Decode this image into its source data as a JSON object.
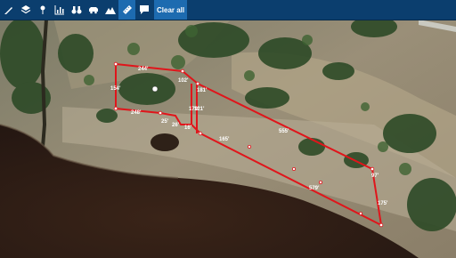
{
  "toolbar": {
    "tools": [
      {
        "name": "draw-line-icon",
        "active": false
      },
      {
        "name": "layers-icon",
        "active": false
      },
      {
        "name": "place-pin-icon",
        "active": false
      },
      {
        "name": "chart-icon",
        "active": false
      },
      {
        "name": "binoculars-icon",
        "active": false
      },
      {
        "name": "car-icon",
        "active": false
      },
      {
        "name": "terrain-icon",
        "active": false
      },
      {
        "name": "ruler-icon",
        "active": true
      },
      {
        "name": "comment-icon",
        "active": false
      }
    ],
    "clear_label": "Clear all"
  },
  "map": {
    "measurements": [
      {
        "id": "seg-1",
        "text": "244'"
      },
      {
        "id": "seg-2",
        "text": "154'"
      },
      {
        "id": "seg-3",
        "text": "248'"
      },
      {
        "id": "seg-4",
        "text": "25'"
      },
      {
        "id": "seg-5",
        "text": "102'"
      },
      {
        "id": "seg-6",
        "text": "181'"
      },
      {
        "id": "seg-7",
        "text": "179'"
      },
      {
        "id": "seg-8",
        "text": "121'"
      },
      {
        "id": "seg-9",
        "text": "26'"
      },
      {
        "id": "seg-10",
        "text": "16'"
      },
      {
        "id": "seg-11",
        "text": "165'"
      },
      {
        "id": "seg-12",
        "text": "555'"
      },
      {
        "id": "seg-13",
        "text": "579'"
      },
      {
        "id": "seg-14",
        "text": "97'"
      },
      {
        "id": "seg-15",
        "text": "175'"
      }
    ],
    "colors": {
      "boundary": "#e0151b",
      "vertex": "#ffffff",
      "water": "#2f1d14"
    }
  }
}
